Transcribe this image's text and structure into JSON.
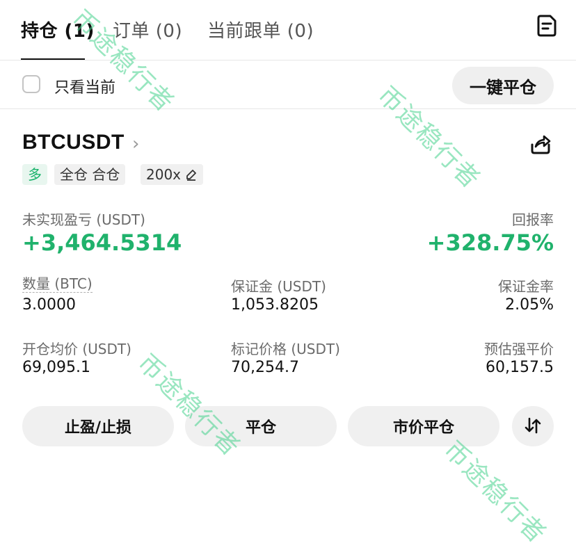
{
  "tabs": [
    {
      "label": "持仓 (1)"
    },
    {
      "label": "订单 (0)"
    },
    {
      "label": "当前跟单 (0)"
    }
  ],
  "filter": {
    "only_current_label": "只看当前",
    "checked": false
  },
  "close_all_label": "一键平仓",
  "position": {
    "symbol": "BTCUSDT",
    "side_tag": "多",
    "mode_tag": "全仓 合仓",
    "leverage": "200x",
    "unrealized_pnl_label": "未实现盈亏 (USDT)",
    "unrealized_pnl": "+3,464.5314",
    "roe_label": "回报率",
    "roe": "+328.75%",
    "qty_label": "数量 (BTC)",
    "qty": "3.0000",
    "margin_label": "保证金 (USDT)",
    "margin": "1,053.8205",
    "margin_ratio_label": "保证金率",
    "margin_ratio": "2.05%",
    "entry_label": "开仓均价 (USDT)",
    "entry": "69,095.1",
    "mark_label": "标记价格 (USDT)",
    "mark": "70,254.7",
    "liq_label": "预估强平价",
    "liq": "60,157.5"
  },
  "actions": {
    "tp_sl_label": "止盈/止损",
    "close_label": "平仓",
    "market_close_label": "市价平仓"
  },
  "colors": {
    "profit": "#20b26c",
    "text": "#111111",
    "muted": "#6b6b6b"
  },
  "icons": [
    "orders-list-icon",
    "chevron-right-icon",
    "share-icon",
    "edit-icon",
    "swap-arrows-icon"
  ],
  "watermark": "币途稳行者"
}
